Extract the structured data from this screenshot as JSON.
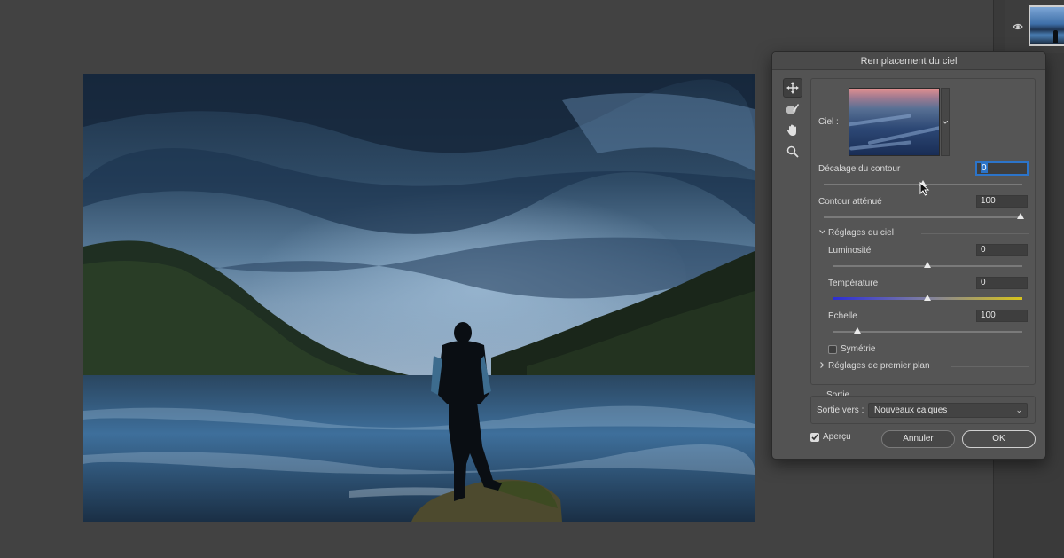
{
  "dialog": {
    "title": "Remplacement du ciel",
    "tools": [
      {
        "name": "move-tool",
        "icon": "move-arrows-icon"
      },
      {
        "name": "sky-brush-tool",
        "icon": "brush-icon"
      },
      {
        "name": "hand-tool",
        "icon": "hand-icon"
      },
      {
        "name": "zoom-tool",
        "icon": "magnifier-icon"
      }
    ],
    "sky_label": "Ciel :",
    "edge_shift": {
      "label": "Décalage du contour",
      "value": "0",
      "level_percent": 50
    },
    "fade_edge": {
      "label": "Contour atténué",
      "value": "100",
      "level_percent": 100
    },
    "sky_adjustments": {
      "label": "Réglages du ciel",
      "brightness": {
        "label": "Luminosité",
        "value": "0",
        "level_percent": 50
      },
      "temperature": {
        "label": "Température",
        "value": "0",
        "level_percent": 50
      },
      "scale": {
        "label": "Echelle",
        "value": "100",
        "level_percent": 17
      },
      "flip": {
        "label": "Symétrie",
        "checked": false
      }
    },
    "foreground_adjustments": {
      "label": "Réglages de premier plan"
    },
    "output": {
      "label": "Sortie",
      "output_to_label": "Sortie vers :",
      "output_to_value": "Nouveaux calques"
    },
    "preview": {
      "label": "Aperçu",
      "checked": true
    },
    "cancel_label": "Annuler",
    "ok_label": "OK"
  },
  "colors": {
    "dialog_bg": "#535353",
    "workspace_bg": "#424242",
    "accent_blue": "#2c74c9"
  }
}
